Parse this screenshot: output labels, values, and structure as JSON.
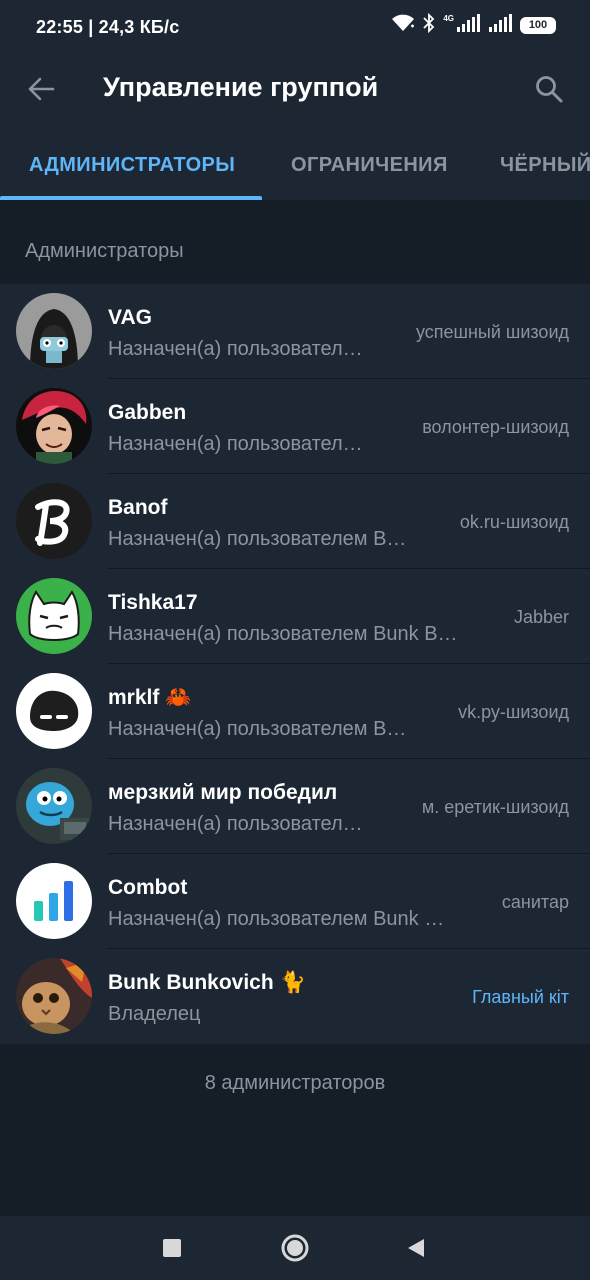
{
  "status_bar": {
    "time_speed": "22:55 | 24,3 КБ/с",
    "network_label": "4G",
    "battery": "100",
    "icons": [
      "wifi-icon",
      "bluetooth-icon",
      "signal-icon",
      "signal-icon",
      "battery-icon"
    ]
  },
  "app_bar": {
    "title": "Управление группой",
    "back_icon": "arrow-left-icon",
    "search_icon": "search-icon"
  },
  "tabs": [
    {
      "label": "АДМИНИСТРАТОРЫ",
      "active": true
    },
    {
      "label": "ОГРАНИЧЕНИЯ",
      "active": false
    },
    {
      "label": "ЧЁРНЫЙ",
      "active": false
    }
  ],
  "section": {
    "header": "Администраторы",
    "footer": "8 администраторов"
  },
  "admins": [
    {
      "name": "VAG",
      "subtitle": "Назначен(а) пользовател…",
      "rank": "успешный шизоид",
      "owner": false
    },
    {
      "name": "Gabben",
      "subtitle": "Назначен(а) пользовател…",
      "rank": "волонтер-шизоид",
      "owner": false
    },
    {
      "name": "Banof",
      "subtitle": "Назначен(а) пользователем B…",
      "rank": "ok.ru-шизоид",
      "owner": false
    },
    {
      "name": "Tishka17",
      "subtitle": "Назначен(а) пользователем Bunk B…",
      "rank": "Jabber",
      "owner": false
    },
    {
      "name": "mrklf 🦀",
      "subtitle": "Назначен(а) пользователем B…",
      "rank": "vk.ру-шизоид",
      "owner": false
    },
    {
      "name": "мерзкий мир победил",
      "subtitle": "Назначен(а) пользовател…",
      "rank": "м. еретик-шизоид",
      "owner": false
    },
    {
      "name": "Combot",
      "subtitle": "Назначен(а) пользователем Bunk …",
      "rank": "санитар",
      "owner": false
    },
    {
      "name": "Bunk Bunkovich 🐈",
      "subtitle": "Владелец",
      "rank": "Главный кіт",
      "owner": true
    }
  ],
  "nav_bar": {
    "icons": [
      "recents-square-icon",
      "home-circle-icon",
      "back-triangle-icon"
    ]
  },
  "colors": {
    "background": "#1d2733",
    "list_bg": "#151d27",
    "accent": "#5eb5f7",
    "secondary_text": "#8a959f"
  }
}
